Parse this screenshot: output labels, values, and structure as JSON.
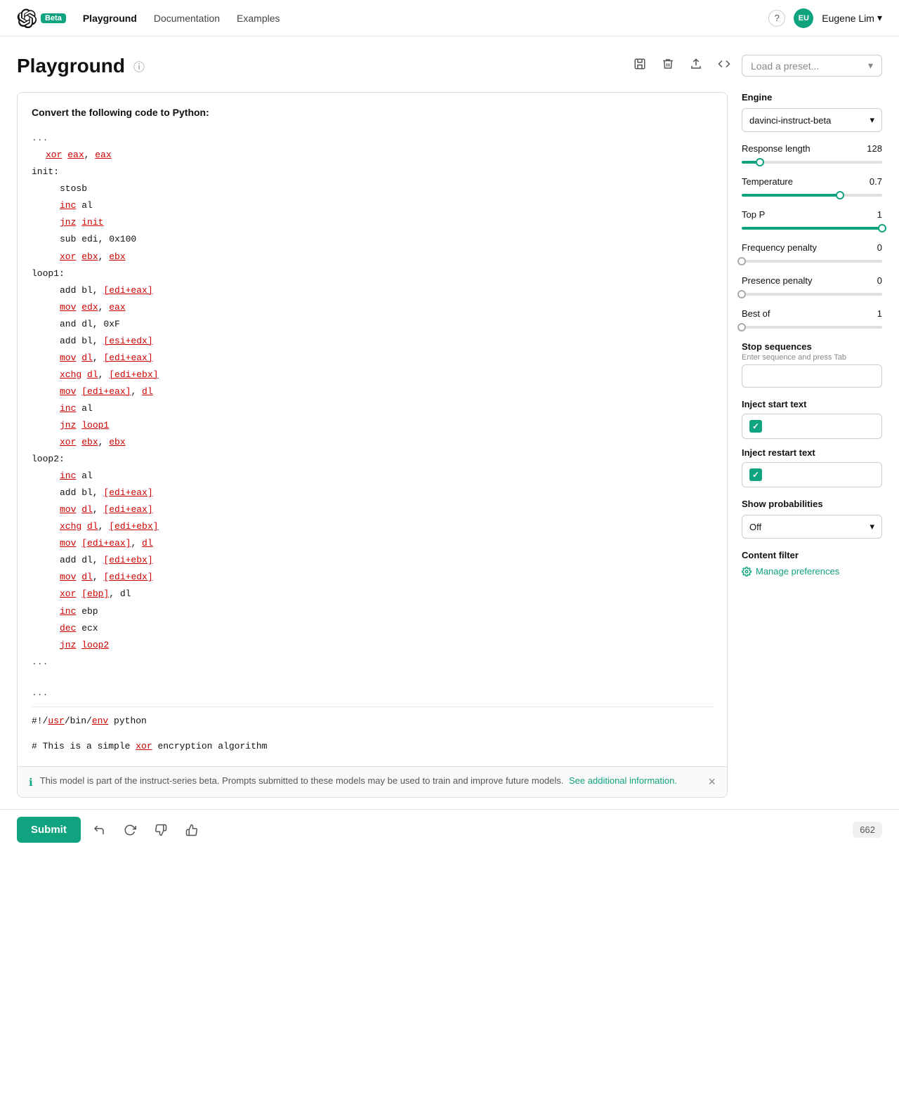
{
  "nav": {
    "logo_alt": "OpenAI",
    "beta_label": "Beta",
    "links": [
      {
        "label": "Playground",
        "active": true
      },
      {
        "label": "Documentation",
        "active": false
      },
      {
        "label": "Examples",
        "active": false
      }
    ],
    "help_icon": "?",
    "user_initials": "EU",
    "username": "Eugene Lim",
    "chevron": "▾"
  },
  "page": {
    "title": "Playground",
    "info_icon": "ⓘ"
  },
  "toolbar": {
    "save_icon": "💾",
    "delete_icon": "🗑",
    "share_icon": "⬆",
    "code_icon": "<>",
    "preset_placeholder": "Load a preset..."
  },
  "editor": {
    "prompt": "Convert the following code to Python:",
    "code_lines": [
      {
        "text": "...",
        "indent": 0
      },
      {
        "text": "xor eax, eax",
        "indent": 1,
        "underlines": [
          "xor",
          "eax,",
          "eax"
        ]
      },
      {
        "text": "init:",
        "indent": 0
      },
      {
        "text": "stosb",
        "indent": 2
      },
      {
        "text": "inc al",
        "indent": 2,
        "underlines": [
          "inc"
        ]
      },
      {
        "text": "jnz init",
        "indent": 2,
        "underlines": [
          "jnz",
          "init"
        ]
      },
      {
        "text": "sub edi, 0x100",
        "indent": 2
      },
      {
        "text": "xor ebx, ebx",
        "indent": 2,
        "underlines": [
          "xor",
          "ebx,",
          "ebx"
        ]
      },
      {
        "text": "loop1:",
        "indent": 0
      },
      {
        "text": "add bl, [edi+eax]",
        "indent": 2,
        "underlines": [
          "[edi+eax]"
        ]
      },
      {
        "text": "mov edx, eax",
        "indent": 2,
        "underlines": [
          "mov",
          "edx,",
          "eax"
        ]
      },
      {
        "text": "and dl, 0xF",
        "indent": 2
      },
      {
        "text": "add bl, [esi+edx]",
        "indent": 2,
        "underlines": [
          "[esi+edx]"
        ]
      },
      {
        "text": "mov dl, [edi+eax]",
        "indent": 2,
        "underlines": [
          "mov",
          "dl,",
          "[edi+eax]"
        ]
      },
      {
        "text": "xchg dl, [edi+ebx]",
        "indent": 2,
        "underlines": [
          "xchg",
          "dl,",
          "[edi+ebx]"
        ]
      },
      {
        "text": "mov [edi+eax], dl",
        "indent": 2,
        "underlines": [
          "mov",
          "[edi+eax],",
          "dl"
        ]
      },
      {
        "text": "inc al",
        "indent": 2,
        "underlines": [
          "inc"
        ]
      },
      {
        "text": "jnz loop1",
        "indent": 2,
        "underlines": [
          "jnz",
          "loop1"
        ]
      },
      {
        "text": "xor ebx, ebx",
        "indent": 2,
        "underlines": [
          "xor",
          "ebx,",
          "ebx"
        ]
      },
      {
        "text": "loop2:",
        "indent": 0
      },
      {
        "text": "inc al",
        "indent": 2,
        "underlines": [
          "inc"
        ]
      },
      {
        "text": "add bl, [edi+eax]",
        "indent": 2,
        "underlines": [
          "[edi+eax]"
        ]
      },
      {
        "text": "mov dl, [edi+eax]",
        "indent": 2,
        "underlines": [
          "mov",
          "dl,",
          "[edi+eax]"
        ]
      },
      {
        "text": "xchg dl, [edi+ebx]",
        "indent": 2,
        "underlines": [
          "xchg",
          "dl,",
          "[edi+ebx]"
        ]
      },
      {
        "text": "mov [edi+eax], dl",
        "indent": 2,
        "underlines": [
          "mov",
          "[edi+eax],",
          "dl"
        ]
      },
      {
        "text": "add dl, [edi+ebx]",
        "indent": 2,
        "underlines": [
          "[edi+ebx]"
        ]
      },
      {
        "text": "mov dl, [edi+edx]",
        "indent": 2,
        "underlines": [
          "mov",
          "dl,",
          "[edi+edx]"
        ]
      },
      {
        "text": "xor [ebp], dl",
        "indent": 2,
        "underlines": [
          "xor",
          "[ebp],",
          "dl"
        ]
      },
      {
        "text": "inc ebp",
        "indent": 2,
        "underlines": [
          "inc"
        ]
      },
      {
        "text": "dec ecx",
        "indent": 2,
        "underlines": [
          "dec"
        ]
      },
      {
        "text": "jnz loop2",
        "indent": 2,
        "underlines": [
          "jnz",
          "loop2"
        ]
      },
      {
        "text": "...",
        "indent": 0
      }
    ],
    "generated_lines": [
      "",
      "...",
      "",
      "#!/usr/bin/env python",
      "",
      "# This is a simple xor encryption algorithm"
    ],
    "info_bar": {
      "text": "This model is part of the instruct-series beta. Prompts submitted to these models may be used to train and improve future models.",
      "link_text": "See additional information.",
      "link_href": "#"
    }
  },
  "sidebar": {
    "engine_label": "Engine",
    "engine_value": "davinci-instruct-beta",
    "params": [
      {
        "label": "Response length",
        "value": "128",
        "fill_pct": 13
      },
      {
        "label": "Temperature",
        "value": "0.7",
        "fill_pct": 70
      },
      {
        "label": "Top P",
        "value": "1",
        "fill_pct": 100
      },
      {
        "label": "Frequency penalty",
        "value": "0",
        "fill_pct": 0
      },
      {
        "label": "Presence penalty",
        "value": "0",
        "fill_pct": 0
      },
      {
        "label": "Best of",
        "value": "1",
        "fill_pct": 0
      }
    ],
    "stop_sequences_label": "Stop sequences",
    "stop_sequences_hint": "Enter sequence and press Tab",
    "inject_start_label": "Inject start text",
    "inject_restart_label": "Inject restart text",
    "show_prob_label": "Show probabilities",
    "show_prob_value": "Off",
    "content_filter_label": "Content filter",
    "manage_prefs_label": "Manage preferences"
  },
  "bottom": {
    "submit_label": "Submit",
    "token_count": "662"
  }
}
